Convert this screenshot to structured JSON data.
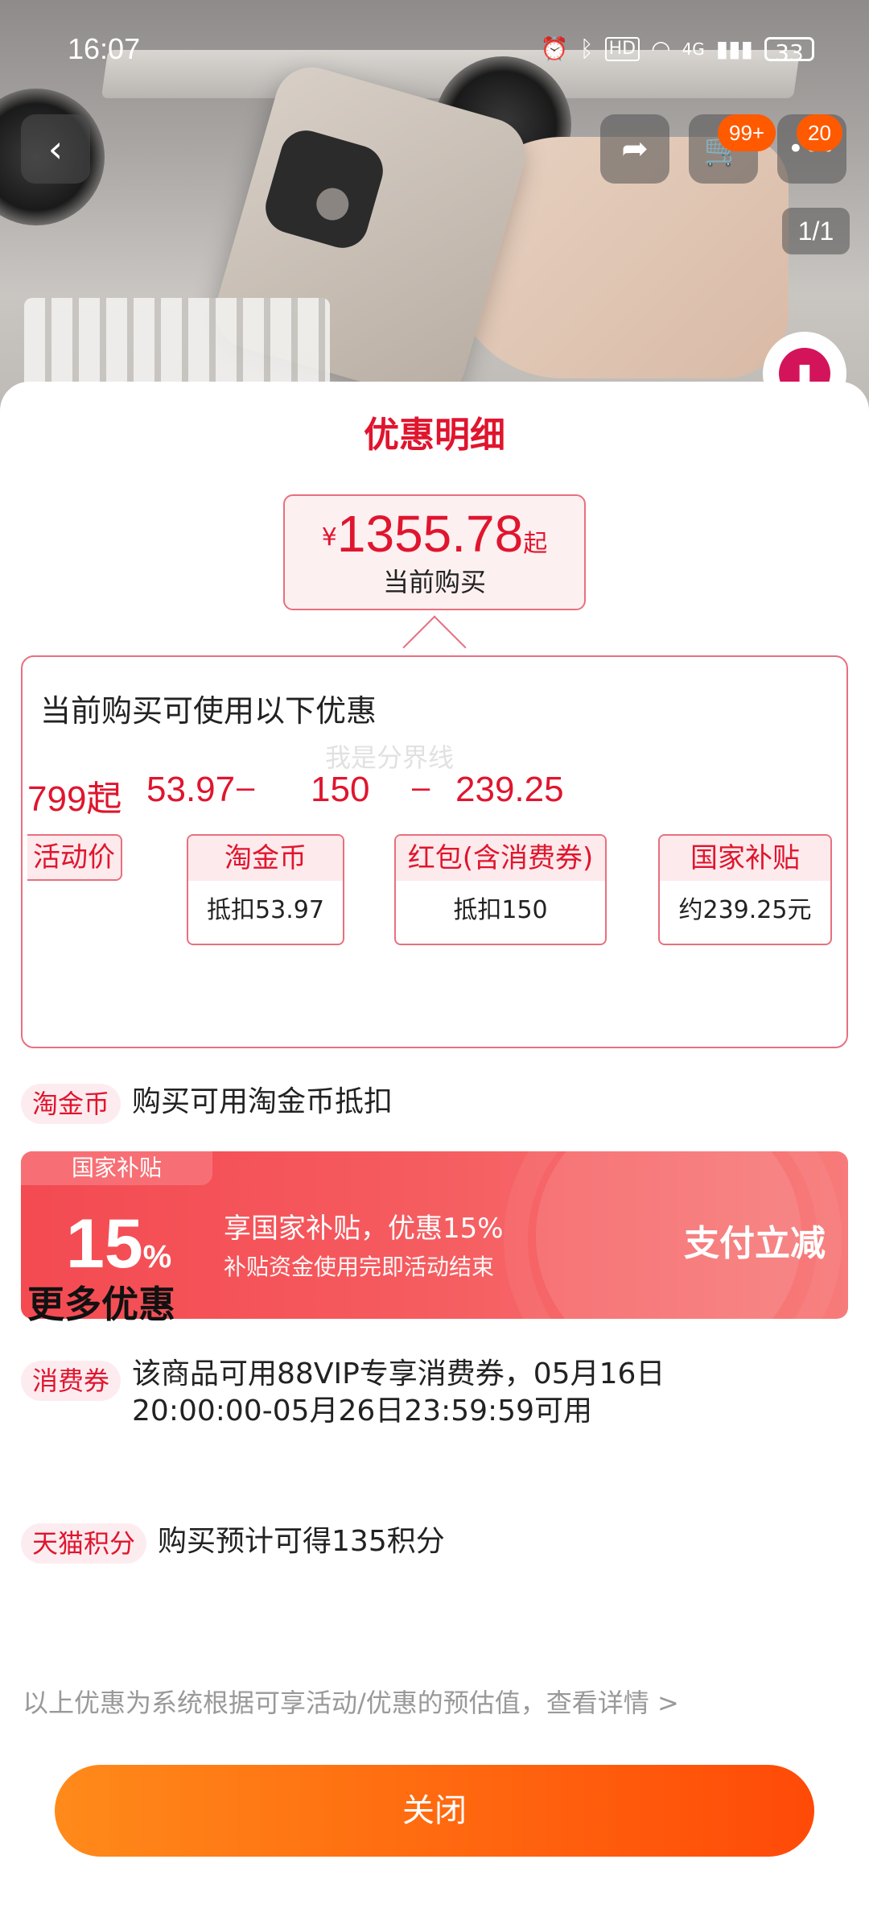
{
  "status_bar": {
    "time": "16:07",
    "network": "4G",
    "hd": "HD",
    "battery": "33"
  },
  "header": {
    "cart_badge": "99+",
    "msg_badge": "20",
    "page_indicator": "1/1"
  },
  "sheet": {
    "title": "优惠明细",
    "price": {
      "currency": "¥",
      "amount": "1355.78",
      "suffix": "起",
      "label": "当前购买"
    },
    "calc": {
      "title": "当前购买可使用以下优惠",
      "items": [
        {
          "value": "799起",
          "head": "活动价",
          "sub": ""
        },
        {
          "value": "53.97",
          "head": "淘金币",
          "sub": "抵扣53.97"
        },
        {
          "value": "150",
          "head": "红包(含消费券)",
          "sub": "抵扣150"
        },
        {
          "value": "239.25",
          "head": "国家补贴",
          "sub": "约239.25元"
        }
      ],
      "operator": "–",
      "watermark": "我是分界线"
    },
    "taojinbi_row": {
      "tag": "淘金币",
      "text": "购买可用淘金币抵扣"
    },
    "subsidy": {
      "tag": "国家补贴",
      "percent_number": "15",
      "percent_sign": "%",
      "main": "享国家补贴，优惠15%",
      "sub": "补贴资金使用完即活动结束",
      "cta": "支付立减"
    },
    "more_title": "更多优惠",
    "coupon_row": {
      "tag": "消费券",
      "line1": "该商品可用88VIP专享消费券，05月16日",
      "line2": "20:00:00-05月26日23:59:59可用"
    },
    "points_row": {
      "tag": "天猫积分",
      "text": "购买预计可得135积分"
    },
    "footnote": "以上优惠为系统根据可享活动/优惠的预估值，查看详情 >",
    "close_label": "关闭"
  },
  "colors": {
    "accent_red": "#e0152e",
    "orange_button": "#ff6a10",
    "subsidy_bg": "#f44a52"
  }
}
